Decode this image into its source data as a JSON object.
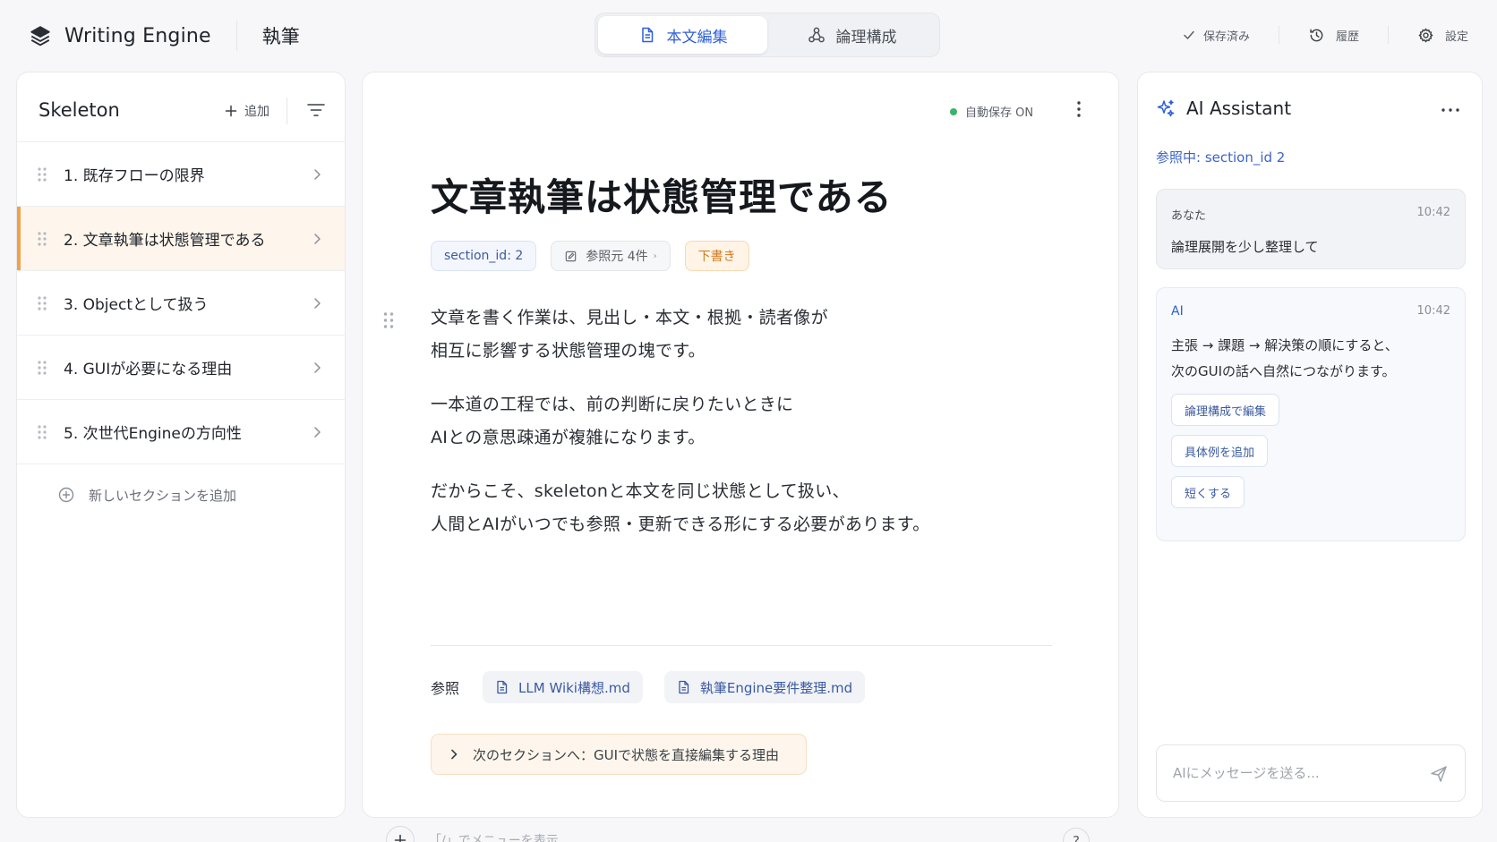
{
  "app": {
    "name": "Writing Engine",
    "mode": "執筆"
  },
  "view_tabs": [
    {
      "label": "本文編集",
      "active": true,
      "icon": "document-icon"
    },
    {
      "label": "論理構成",
      "active": false,
      "icon": "structure-icon"
    }
  ],
  "top_actions": {
    "saved": "保存済み",
    "history": "履歴",
    "settings": "設定"
  },
  "skeleton": {
    "title": "Skeleton",
    "add_label": "追加",
    "sections": [
      {
        "label": "1. 既存フローの限界",
        "active": false
      },
      {
        "label": "2. 文章執筆は状態管理である",
        "active": true
      },
      {
        "label": "3. Objectとして扱う",
        "active": false
      },
      {
        "label": "4. GUIが必要になる理由",
        "active": false
      },
      {
        "label": "5. 次世代Engineの方向性",
        "active": false
      }
    ],
    "new_section_label": "新しいセクションを追加"
  },
  "editor": {
    "autosave_label": "自動保存 ON",
    "title": "文章執筆は状態管理である",
    "section_id_chip": "section_id: 2",
    "source_chip": "参照元 4件",
    "source_chip_arrow": "›",
    "status_chip": "下書き",
    "paragraphs": [
      [
        "文章を書く作業は、見出し・本文・根拠・読者像が",
        "相互に影響する状態管理の塊です。"
      ],
      [
        "一本道の工程では、前の判断に戻りたいときに",
        "AIとの意思疎通が複雑になります。"
      ],
      [
        "だからこそ、skeletonと本文を同じ状態として扱い、",
        "人間とAIがいつでも参照・更新できる形にする必要があります。"
      ]
    ],
    "references_label": "参照",
    "references": [
      "LLM Wiki構想.md",
      "執筆Engine要件整理.md"
    ],
    "next_section_label": "次のセクションへ：GUIで状態を直接編集する理由",
    "slash_hint": "「/」でメニューを表示",
    "help_label": "?"
  },
  "assistant": {
    "title": "AI Assistant",
    "reference_label": "参照中: section_id 2",
    "messages": [
      {
        "sender": "あなた",
        "time": "10:42",
        "lines": [
          "論理展開を少し整理して"
        ]
      },
      {
        "sender": "AI",
        "time": "10:42",
        "lines": [
          "主張 → 課題 → 解決策の順にすると、",
          "次のGUIの話へ自然につながります。"
        ]
      }
    ],
    "suggestions": [
      "論理構成で編集",
      "具体例を追加",
      "短くする"
    ],
    "input_placeholder": "AIにメッセージを送る..."
  },
  "colors": {
    "accent_blue": "#2d5fd8",
    "accent_orange": "#f0a24a",
    "status_green": "#3cb26a",
    "background": "#f7f7f9"
  }
}
